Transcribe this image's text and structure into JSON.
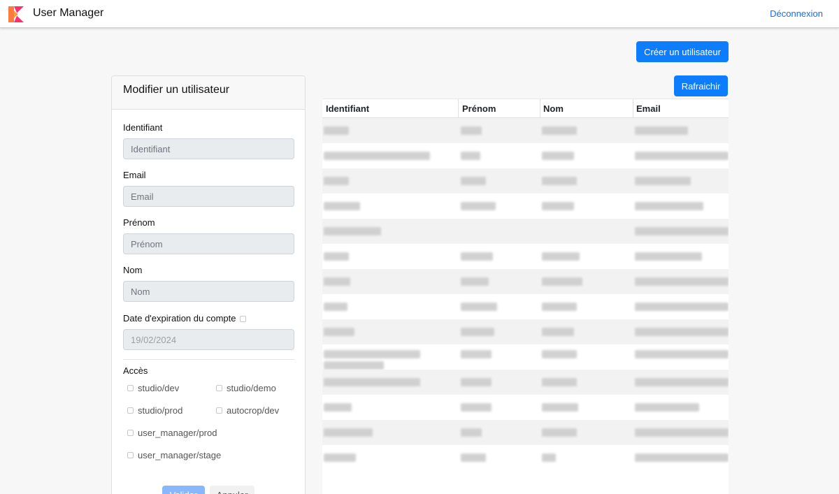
{
  "header": {
    "title": "User Manager",
    "logout_label": "Déconnexion"
  },
  "toolbar": {
    "create_label": "Créer un utilisateur",
    "refresh_label": "Rafraichir"
  },
  "form": {
    "title": "Modifier un utilisateur",
    "fields": [
      {
        "label": "Identifiant",
        "placeholder": "Identifiant"
      },
      {
        "label": "Email",
        "placeholder": "Email"
      },
      {
        "label": "Prénom",
        "placeholder": "Prénom"
      },
      {
        "label": "Nom",
        "placeholder": "Nom"
      }
    ],
    "expiration": {
      "label": "Date d'expiration du compte",
      "placeholder": "19/02/2024"
    },
    "access": {
      "label": "Accès",
      "items": [
        "studio/dev",
        "studio/demo",
        "studio/prod",
        "autocrop/dev",
        "user_manager/prod",
        "user_manager/stage"
      ]
    },
    "validate_label": "Valider",
    "cancel_label": "Annuler"
  },
  "table": {
    "headers": [
      "Identifiant",
      "Prénom",
      "Nom",
      "Email"
    ]
  },
  "colors": {
    "accent": "#0d7cfd",
    "link": "#0d6efd",
    "logo_orange": "#ff7a3d",
    "logo_pink": "#ff2f6e"
  }
}
